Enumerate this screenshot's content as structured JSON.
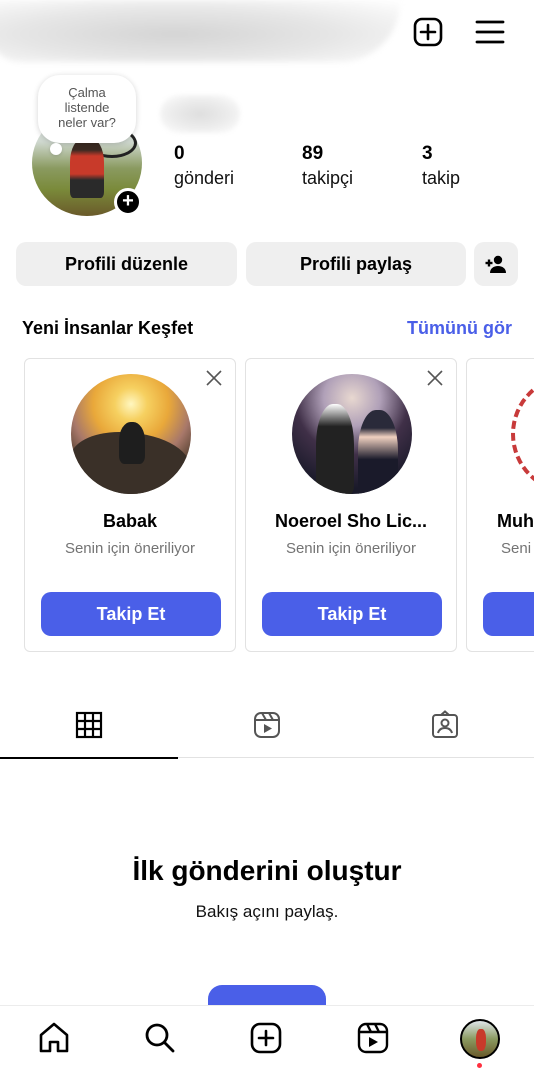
{
  "note": {
    "lines": [
      "Çalma",
      "listende",
      "neler var?"
    ]
  },
  "stats": [
    {
      "value": "0",
      "label": "gönderi"
    },
    {
      "value": "89",
      "label": "takipçi"
    },
    {
      "value": "3",
      "label": "takip"
    }
  ],
  "actions": {
    "edit_profile": "Profili düzenle",
    "share_profile": "Profili paylaş"
  },
  "discover": {
    "title": "Yeni İnsanlar Keşfet",
    "see_all": "Tümünü gör",
    "cards": [
      {
        "name": "Babak",
        "subtitle": "Senin için öneriliyor",
        "button": "Takip Et"
      },
      {
        "name": "Noeroel Sho Lic...",
        "subtitle": "Senin için öneriliyor",
        "button": "Takip Et"
      },
      {
        "name": "Muh",
        "subtitle": "Seni",
        "button": ""
      }
    ]
  },
  "empty_state": {
    "title": "İlk gönderini oluştur",
    "subtitle": "Bakış açını paylaş."
  },
  "colors": {
    "accent": "#4a5fe8",
    "button_gray": "#efefef",
    "secondary_text": "#737373",
    "notification_dot": "#ff3040"
  },
  "icons": {
    "top": [
      "new-post-icon",
      "menu-icon"
    ],
    "tabs": [
      "grid-icon",
      "reels-icon",
      "tagged-icon"
    ],
    "nav": [
      "home-icon",
      "search-icon",
      "create-icon",
      "reels-icon",
      "profile-avatar"
    ]
  }
}
